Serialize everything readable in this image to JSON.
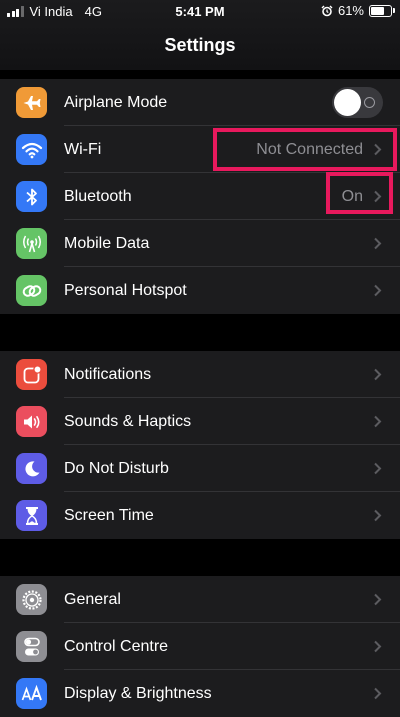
{
  "status_bar": {
    "carrier": "Vi India",
    "network": "4G",
    "time": "5:41 PM",
    "battery": "61%",
    "battery_level": 0.61
  },
  "header": {
    "title": "Settings"
  },
  "colors": {
    "highlight": "#e8195d",
    "value_text": "#8e8e93"
  },
  "groups": [
    {
      "items": [
        {
          "label": "Airplane Mode",
          "icon": "airplane-icon",
          "icon_bg": "#f09a37",
          "toggle": "off"
        },
        {
          "label": "Wi-Fi",
          "icon": "wifi-icon",
          "icon_bg": "#3478f6",
          "value": "Not Connected"
        },
        {
          "label": "Bluetooth",
          "icon": "bluetooth-icon",
          "icon_bg": "#3478f6",
          "value": "On"
        },
        {
          "label": "Mobile Data",
          "icon": "antenna-icon",
          "icon_bg": "#65c466"
        },
        {
          "label": "Personal Hotspot",
          "icon": "hotspot-link-icon",
          "icon_bg": "#65c466"
        }
      ]
    },
    {
      "items": [
        {
          "label": "Notifications",
          "icon": "notifications-icon",
          "icon_bg": "#eb4d3d"
        },
        {
          "label": "Sounds & Haptics",
          "icon": "speaker-icon",
          "icon_bg": "#eb4e5e"
        },
        {
          "label": "Do Not Disturb",
          "icon": "moon-icon",
          "icon_bg": "#5e5ce6"
        },
        {
          "label": "Screen Time",
          "icon": "hourglass-icon",
          "icon_bg": "#5e5ce6"
        }
      ]
    },
    {
      "items": [
        {
          "label": "General",
          "icon": "gear-icon",
          "icon_bg": "#8e8e93"
        },
        {
          "label": "Control Centre",
          "icon": "switches-icon",
          "icon_bg": "#8e8e93"
        },
        {
          "label": "Display & Brightness",
          "icon": "text-size-icon",
          "icon_bg": "#3478f6"
        }
      ]
    }
  ]
}
